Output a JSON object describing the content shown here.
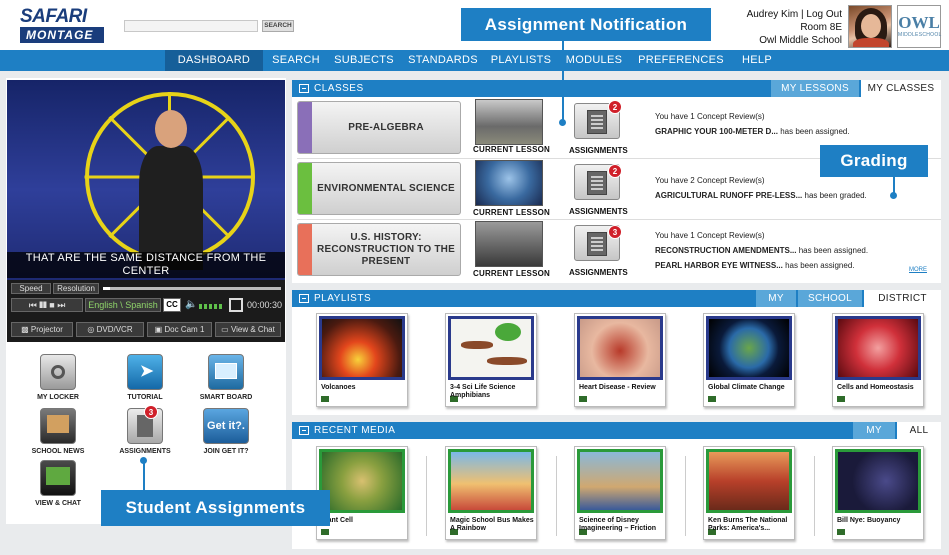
{
  "header": {
    "logo_top": "SAFARI",
    "logo_bottom": "MONTAGE",
    "search_placeholder": "",
    "search_button": "SEARCH",
    "user_line": "Audrey Kim | Log Out",
    "room": "Room 8E",
    "school": "Owl Middle School",
    "school_logo_text": "OWL",
    "school_logo_sub": "MIDDLESCHOOL"
  },
  "nav": [
    "DASHBOARD",
    "SEARCH",
    "SUBJECTS",
    "STANDARDS",
    "PLAYLISTS",
    "MODULES",
    "PREFERENCES",
    "HELP"
  ],
  "player": {
    "caption": "THAT ARE THE SAME DISTANCE FROM THE CENTER",
    "speed": "Speed",
    "resolution": "Resolution",
    "language": "English \\ Spanish",
    "cc": "CC",
    "time": "00:00:30",
    "projector": "Projector",
    "dvd": "DVD/VCR",
    "doccam": "Doc Cam 1",
    "viewchat": "View & Chat"
  },
  "apps": [
    {
      "label": "MY LOCKER"
    },
    {
      "label": "TUTORIAL"
    },
    {
      "label": "SMART BOARD"
    },
    {
      "label": "SCHOOL NEWS"
    },
    {
      "label": "ASSIGNMENTS",
      "badge": "3"
    },
    {
      "label": "JOIN GET IT?",
      "tile_text": "Get it?."
    },
    {
      "label": "VIEW & CHAT"
    }
  ],
  "callouts": {
    "assignment_notification": "Assignment Notification",
    "grading": "Grading",
    "student_assignments": "Student Assignments"
  },
  "classes": {
    "title": "CLASSES",
    "tabs": [
      "MY LESSONS",
      "MY CLASSES"
    ],
    "current_lesson_label": "CURRENT LESSON",
    "assignments_label": "ASSIGNMENTS",
    "more": "MORE",
    "rows": [
      {
        "name": "PRE-ALGEBRA",
        "color": "#8a6fb8",
        "badge": "2",
        "msg1": "You have 1 Concept Review(s)",
        "msg2_bold": "GRAPHIC YOUR 100-METER D...",
        "msg2_rest": " has been assigned."
      },
      {
        "name": "ENVIRONMENTAL SCIENCE",
        "color": "#6bbf3f",
        "badge": "2",
        "msg1": "You have 2 Concept Review(s)",
        "msg2_bold": "AGRICULTURAL RUNOFF PRE-LESS...",
        "msg2_rest": " has been graded."
      },
      {
        "name": "U.S. HISTORY: RECONSTRUCTION TO THE PRESENT",
        "color": "#e8705a",
        "badge": "3",
        "msg1": "You have 1 Concept Review(s)",
        "msg2_bold": "RECONSTRUCTION AMENDMENTS...",
        "msg2_rest": " has been assigned.",
        "msg3_bold": "PEARL HARBOR EYE WITNESS...",
        "msg3_rest": " has been assigned."
      }
    ]
  },
  "playlists": {
    "title": "PLAYLISTS",
    "tabs": [
      "MY",
      "SCHOOL",
      "DISTRICT"
    ],
    "items": [
      "Volcanoes",
      "3-4 Sci Life Science Amphibians",
      "Heart Disease - Review",
      "Global Climate Change",
      "Cells and Homeostasis"
    ]
  },
  "recent": {
    "title": "RECENT MEDIA",
    "tabs": [
      "MY",
      "ALL"
    ],
    "items": [
      "Plant Cell",
      "Magic School Bus Makes A Rainbow",
      "Science of Disney Imagineering – Friction",
      "Ken Burns The National Parks: America's...",
      "Bill Nye: Buoyancy"
    ]
  },
  "colors": {
    "brand": "#1e7fc4",
    "nav_active": "#165f99",
    "badge": "#d0202a"
  }
}
